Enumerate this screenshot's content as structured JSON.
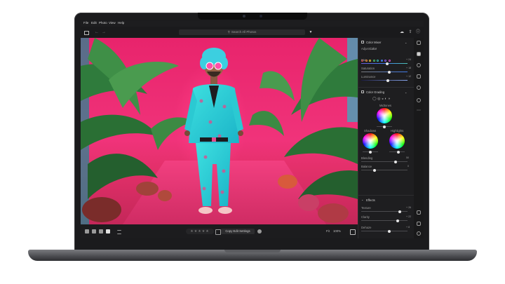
{
  "menu": [
    "File",
    "Edit",
    "Photo",
    "View",
    "Help"
  ],
  "search": {
    "placeholder": "Search All Photos"
  },
  "panel": {
    "color_mixer": {
      "title": "Color Mixer",
      "adjust_label": "Adjust",
      "adjust_value": "Color",
      "hue_label": "Hue",
      "hue_value": "+ 24",
      "saturation_label": "Saturation",
      "saturation_value": "+ 18",
      "luminance_label": "Luminance",
      "luminance_value": "+ 12",
      "swatches": [
        "#e5484d",
        "#f08c2b",
        "#e8c33a",
        "#4cc36b",
        "#34b6b4",
        "#3f7be8",
        "#8a55e6",
        "#d64fc6"
      ]
    },
    "color_grading": {
      "title": "Color Grading",
      "midtones_label": "Midtones",
      "shadows_label": "Shadows",
      "highlights_label": "Highlights",
      "blending_label": "Blending",
      "blending_value": "50",
      "balance_label": "Balance",
      "balance_value": "0"
    },
    "effects": {
      "title": "Effects",
      "texture_label": "Texture",
      "texture_value": "+ 26",
      "clarity_label": "Clarity",
      "clarity_value": "+ 22",
      "dehaze_label": "Dehaze",
      "dehaze_value": "+ 8"
    }
  },
  "bottombar": {
    "stars": "★★★★★",
    "copy_button": "Copy Edit Settings",
    "fit_label": "Fit",
    "zoom": "100%"
  }
}
